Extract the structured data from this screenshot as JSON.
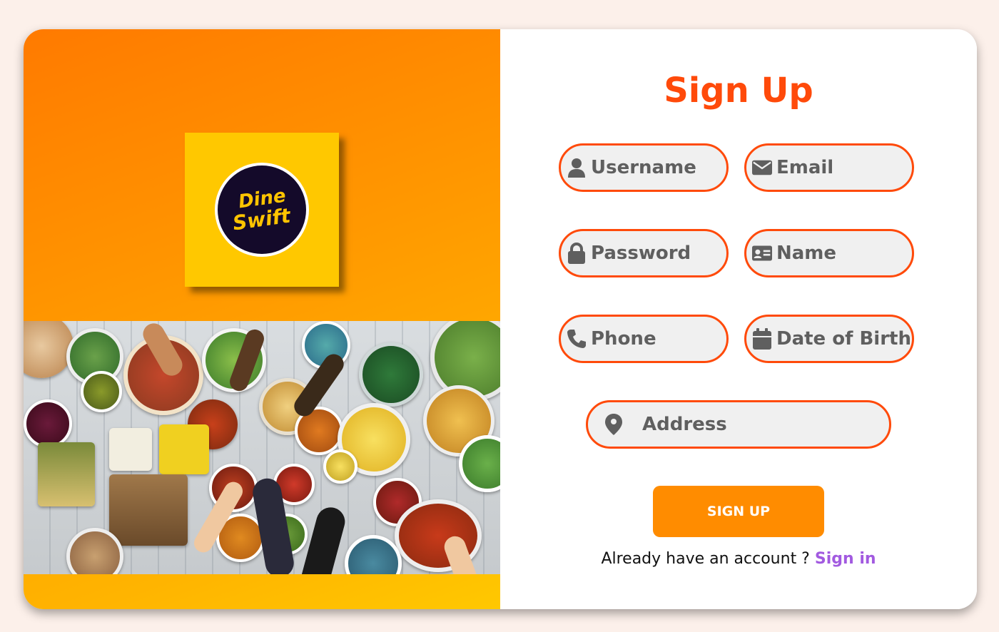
{
  "brand": {
    "logo_line1": "Dine",
    "logo_line2": "Swift"
  },
  "form": {
    "title": "Sign Up",
    "fields": {
      "username": {
        "placeholder": "Username",
        "icon": "user-icon"
      },
      "email": {
        "placeholder": "Email",
        "icon": "envelope-icon"
      },
      "password": {
        "placeholder": "Password",
        "icon": "lock-icon"
      },
      "name": {
        "placeholder": "Name",
        "icon": "id-card-icon"
      },
      "phone": {
        "placeholder": "Phone",
        "icon": "phone-icon"
      },
      "dob": {
        "placeholder": "Date of Birth",
        "icon": "calendar-icon"
      },
      "address": {
        "placeholder": "Address",
        "icon": "map-pin-icon"
      }
    },
    "submit_label": "SIGN UP",
    "signin_prompt": "Already have an account ?",
    "signin_link": "Sign in"
  },
  "colors": {
    "accent": "#ff4a0a",
    "button": "#ff8c00",
    "link": "#a25ae0",
    "field_bg": "#f0f0f0",
    "page_bg": "#fcf0ea"
  }
}
